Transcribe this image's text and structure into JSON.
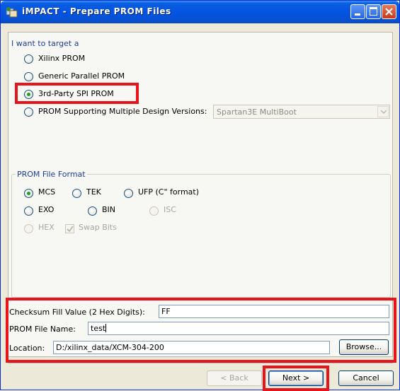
{
  "window": {
    "title": "iMPACT - Prepare PROM Files"
  },
  "target": {
    "heading": "I want to target a",
    "options": [
      {
        "label": "Xilinx PROM",
        "selected": false
      },
      {
        "label": "Generic Parallel PROM",
        "selected": false
      },
      {
        "label": "3rd-Party SPI PROM",
        "selected": true
      },
      {
        "label": "PROM Supporting Multiple Design Versions:",
        "selected": false
      }
    ],
    "multiboot_select": {
      "value": "Spartan3E MultiBoot",
      "enabled": false
    }
  },
  "format": {
    "heading": "PROM File Format",
    "options": [
      {
        "label": "MCS",
        "selected": true,
        "enabled": true
      },
      {
        "label": "TEK",
        "selected": false,
        "enabled": true
      },
      {
        "label": "UFP (C\" format)",
        "selected": false,
        "enabled": true
      },
      {
        "label": "EXO",
        "selected": false,
        "enabled": true
      },
      {
        "label": "BIN",
        "selected": false,
        "enabled": true
      },
      {
        "label": "ISC",
        "selected": false,
        "enabled": false
      },
      {
        "label": "HEX",
        "selected": false,
        "enabled": false
      }
    ],
    "swap_bits": {
      "label": "Swap Bits",
      "checked": true,
      "enabled": false
    }
  },
  "fields": {
    "checksum_label": "Checksum Fill Value (2 Hex Digits):",
    "checksum_value": "FF",
    "filename_label": "PROM File Name:",
    "filename_value": "test",
    "location_label": "Location:",
    "location_value": "D:/xilinx_data/XCM-304-200",
    "browse_label": "Browse..."
  },
  "buttons": {
    "back": "< Back",
    "next": "Next >",
    "cancel": "Cancel"
  },
  "colors": {
    "highlight": "#e8141c",
    "radio_dot": "#21a121",
    "titlebar": "#0554e2"
  }
}
